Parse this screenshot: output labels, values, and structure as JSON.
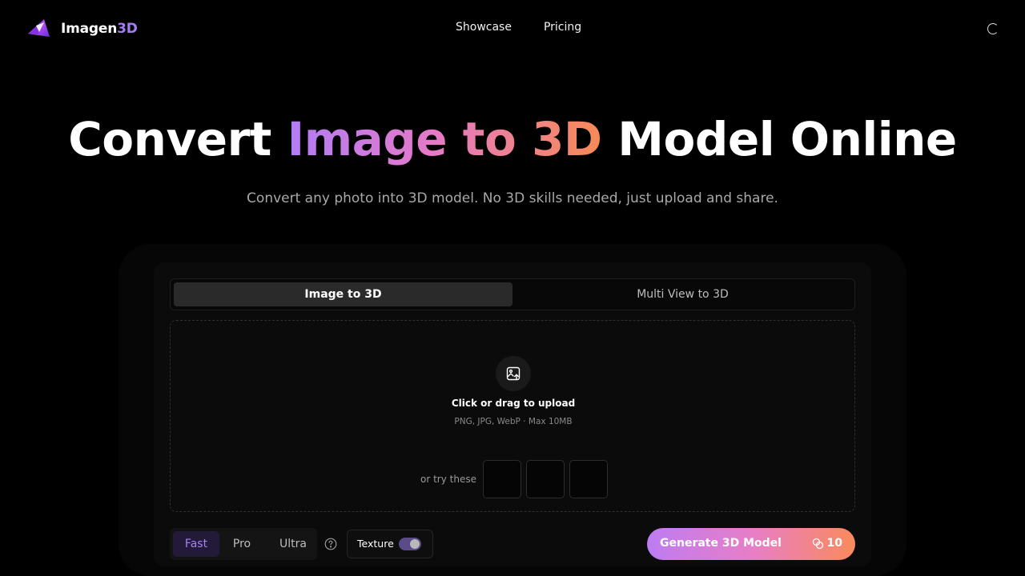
{
  "header": {
    "logo_text": "Imagen",
    "logo_accent": "3D",
    "nav": [
      {
        "label": "Showcase"
      },
      {
        "label": "Pricing"
      }
    ]
  },
  "hero": {
    "title_prefix": "Convert ",
    "title_highlight": "Image to 3D",
    "title_suffix": " Model Online",
    "subtitle": "Convert any photo into 3D model. No 3D skills needed, just upload and share."
  },
  "tabs": [
    {
      "label": "Image to 3D",
      "active": true
    },
    {
      "label": "Multi View to 3D",
      "active": false
    }
  ],
  "upload": {
    "title": "Click or drag to upload",
    "hint": "PNG, JPG, WebP · Max 10MB",
    "try_label": "or try these",
    "samples": 3
  },
  "quality": {
    "options": [
      "Fast",
      "Pro",
      "Ultra"
    ],
    "selected": "Fast"
  },
  "texture": {
    "label": "Texture",
    "enabled": true
  },
  "generate": {
    "label": "Generate 3D Model",
    "credits": "10"
  },
  "colors": {
    "accent": "#a47cf3",
    "gradient_start": "#bd7cf2",
    "gradient_mid": "#e77ec8",
    "gradient_end": "#fb8a5c"
  },
  "icons": [
    "logo-icon",
    "loading-spinner-icon",
    "image-upload-icon",
    "help-circle-icon",
    "credits-coin-icon"
  ]
}
